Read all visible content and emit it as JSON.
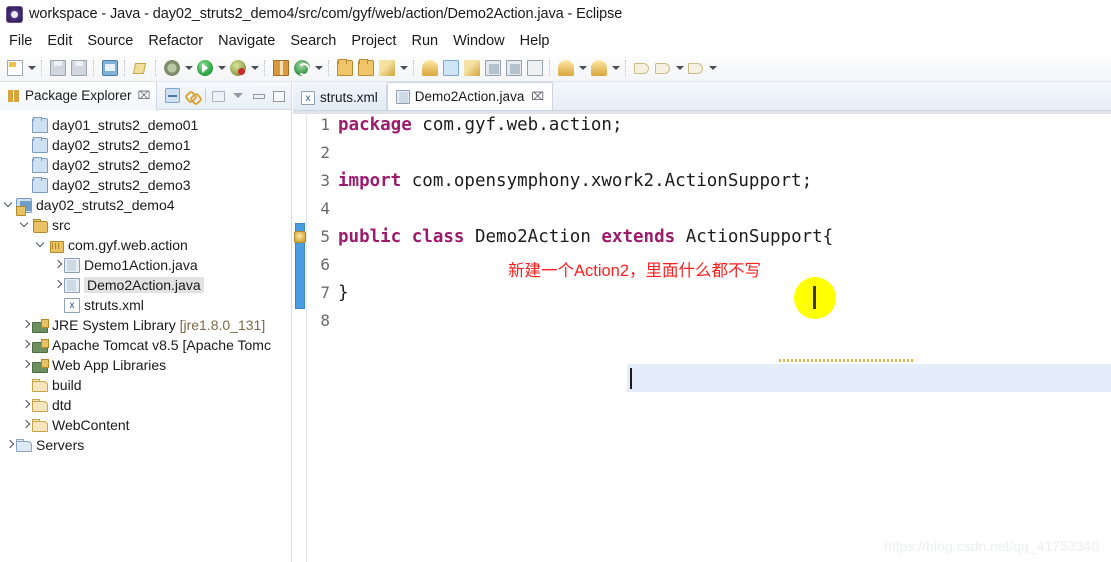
{
  "window": {
    "title": "workspace - Java - day02_struts2_demo4/src/com/gyf/web/action/Demo2Action.java - Eclipse",
    "app_icon": "eclipse-icon"
  },
  "menubar": {
    "items": [
      {
        "label": "File"
      },
      {
        "label": "Edit"
      },
      {
        "label": "Source"
      },
      {
        "label": "Refactor"
      },
      {
        "label": "Navigate"
      },
      {
        "label": "Search"
      },
      {
        "label": "Project"
      },
      {
        "label": "Run"
      },
      {
        "label": "Window"
      },
      {
        "label": "Help"
      }
    ]
  },
  "toolbar": {
    "groups": [
      {
        "items": [
          {
            "icon": "new-document-icon",
            "dropdown": true
          },
          {
            "icon": "save-icon",
            "dropdown": false
          },
          {
            "icon": "save-all-icon",
            "dropdown": false
          }
        ]
      },
      {
        "items": [
          {
            "icon": "print-icon",
            "dropdown": false
          }
        ]
      },
      {
        "items": [
          {
            "icon": "build-icon",
            "dropdown": false
          }
        ]
      },
      {
        "items": [
          {
            "icon": "debug-icon",
            "dropdown": true
          },
          {
            "icon": "run-icon",
            "dropdown": true
          },
          {
            "icon": "run-external-tools-icon",
            "dropdown": true
          }
        ]
      },
      {
        "items": [
          {
            "icon": "new-package-icon",
            "dropdown": false
          },
          {
            "icon": "new-class-icon",
            "dropdown": true
          }
        ]
      },
      {
        "items": [
          {
            "icon": "open-type-icon",
            "dropdown": false
          },
          {
            "icon": "open-task-icon",
            "dropdown": false
          },
          {
            "icon": "quick-fix-icon",
            "dropdown": true
          }
        ]
      },
      {
        "items": [
          {
            "icon": "server-icon",
            "dropdown": false
          },
          {
            "icon": "highlight-icon",
            "dropdown": false,
            "selected": true
          },
          {
            "icon": "link-icon",
            "dropdown": false
          },
          {
            "icon": "marker-icon",
            "dropdown": false
          },
          {
            "icon": "annotation-icon",
            "dropdown": false
          },
          {
            "icon": "step-icon",
            "dropdown": false
          }
        ]
      },
      {
        "items": [
          {
            "icon": "previous-annotation-icon",
            "dropdown": true
          },
          {
            "icon": "next-annotation-icon",
            "dropdown": true
          }
        ]
      },
      {
        "items": [
          {
            "icon": "back-icon",
            "dropdown": false
          },
          {
            "icon": "forward-icon",
            "dropdown": true
          },
          {
            "icon": "history-icon",
            "dropdown": true
          }
        ]
      }
    ]
  },
  "explorer": {
    "tab": {
      "label": "Package Explorer",
      "icon": "package-explorer-icon",
      "close": "⌧"
    },
    "tools": [
      {
        "icon": "collapse-all-icon"
      },
      {
        "icon": "link-with-editor-icon"
      },
      {
        "icon": "view-menu-package-icon"
      },
      {
        "icon": "view-menu-icon"
      },
      {
        "icon": "minimize-icon"
      },
      {
        "icon": "maximize-icon"
      }
    ],
    "tree": [
      {
        "label": "day01_struts2_demo01",
        "icon": "project-closed-icon",
        "indent": 1,
        "chevron": "none",
        "selected": false
      },
      {
        "label": "day02_struts2_demo1",
        "icon": "project-closed-icon",
        "indent": 1,
        "chevron": "none",
        "selected": false
      },
      {
        "label": "day02_struts2_demo2",
        "icon": "project-closed-icon",
        "indent": 1,
        "chevron": "none",
        "selected": false
      },
      {
        "label": "day02_struts2_demo3",
        "icon": "project-closed-icon",
        "indent": 1,
        "chevron": "none",
        "selected": false
      },
      {
        "label": "day02_struts2_demo4",
        "icon": "java-project-icon",
        "indent": 0,
        "chevron": "open",
        "selected": false
      },
      {
        "label": "src",
        "icon": "source-folder-icon",
        "indent": 1,
        "chevron": "open",
        "selected": false
      },
      {
        "label": "com.gyf.web.action",
        "icon": "package-icon",
        "indent": 2,
        "chevron": "open",
        "selected": false
      },
      {
        "label": "Demo1Action.java",
        "icon": "java-file-icon",
        "indent": 3,
        "chevron": "closed",
        "selected": false
      },
      {
        "label": "Demo2Action.java",
        "icon": "java-file-icon",
        "indent": 3,
        "chevron": "closed",
        "selected": true
      },
      {
        "label": "struts.xml",
        "icon": "xml-file-icon",
        "indent": 3,
        "chevron": "none",
        "selected": false
      },
      {
        "label": "JRE System Library ",
        "dim": "[jre1.8.0_131]",
        "icon": "library-icon",
        "indent": 1,
        "chevron": "closed",
        "selected": false
      },
      {
        "label": "Apache Tomcat v8.5 [Apache Tomc",
        "icon": "library-icon",
        "indent": 1,
        "chevron": "closed",
        "selected": false
      },
      {
        "label": "Web App Libraries",
        "icon": "library-icon",
        "indent": 1,
        "chevron": "closed",
        "selected": false
      },
      {
        "label": "build",
        "icon": "folder-icon",
        "indent": 1,
        "chevron": "none",
        "selected": false
      },
      {
        "label": "dtd",
        "icon": "folder-icon",
        "indent": 1,
        "chevron": "closed",
        "selected": false
      },
      {
        "label": "WebContent",
        "icon": "folder-icon",
        "indent": 1,
        "chevron": "closed",
        "selected": false
      },
      {
        "label": "Servers",
        "icon": "servers-icon",
        "indent": 0,
        "chevron": "closed",
        "selected": false
      }
    ]
  },
  "editor": {
    "tabs": [
      {
        "label": "struts.xml",
        "icon": "xml-file-icon",
        "active": false,
        "closable": false
      },
      {
        "label": "Demo2Action.java",
        "icon": "java-file-icon",
        "active": true,
        "closable": true,
        "close": "⌧"
      }
    ],
    "lines": [
      {
        "number": "1",
        "segments": [
          {
            "text": "package",
            "type": "keyword"
          },
          {
            "text": " com.gyf.web.action;",
            "type": "plain"
          }
        ]
      },
      {
        "number": "2",
        "segments": []
      },
      {
        "number": "3",
        "segments": [
          {
            "text": "import",
            "type": "keyword"
          },
          {
            "text": " com.opensymphony.xwork2.ActionSupport;",
            "type": "plain"
          }
        ]
      },
      {
        "number": "4",
        "segments": []
      },
      {
        "number": "5",
        "segments": [
          {
            "text": "public class",
            "type": "keyword"
          },
          {
            "text": " Demo2Action ",
            "type": "plain"
          },
          {
            "text": "extends",
            "type": "keyword"
          },
          {
            "text": " ActionSupport{",
            "type": "plain"
          }
        ]
      },
      {
        "number": "6",
        "segments": [],
        "current": true
      },
      {
        "number": "7",
        "segments": [
          {
            "text": "}",
            "type": "plain"
          }
        ]
      },
      {
        "number": "8",
        "segments": []
      }
    ],
    "annotation_marker": {
      "icon": "warning-marker-icon",
      "line": 5
    },
    "overlay_note": {
      "text": "新建一个Action2，里面什么都不写",
      "color": "#ff1f1f"
    },
    "mouse_cursor": {
      "icon": "text-cursor-icon",
      "highlight_color": "#ffff00"
    }
  },
  "watermark": {
    "text": "https://blog.csdn.net/qq_41753340"
  },
  "colors": {
    "keyword": "#9c1b6d",
    "current_line": "#e4eefb",
    "annotation_red": "#ff1f1f",
    "selection_gray": "#e2e2e2",
    "annotation_bar_blue": "#4a9de0"
  }
}
